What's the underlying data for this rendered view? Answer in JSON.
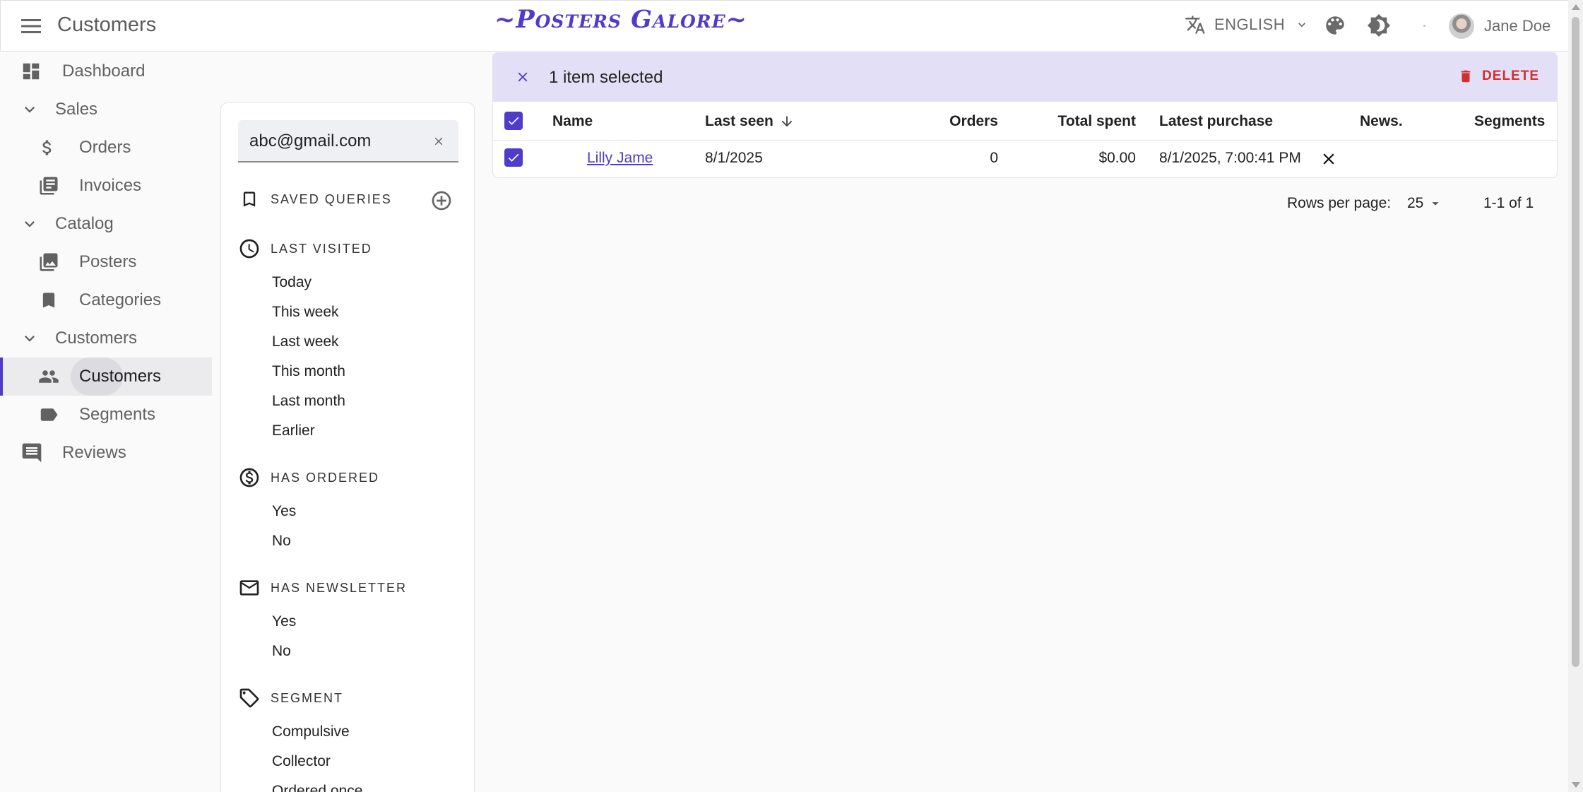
{
  "appbar": {
    "title": "Customers",
    "brand": "~Posters Galore~",
    "language": "ENGLISH",
    "user_name": "Jane Doe"
  },
  "sidebar": {
    "items": [
      {
        "label": "Dashboard",
        "icon": "dashboard-icon"
      },
      {
        "label": "Sales",
        "icon": "chevron-down-icon"
      },
      {
        "label": "Orders",
        "icon": "dollar-icon"
      },
      {
        "label": "Invoices",
        "icon": "invoice-icon"
      },
      {
        "label": "Catalog",
        "icon": "chevron-down-icon"
      },
      {
        "label": "Posters",
        "icon": "image-icon"
      },
      {
        "label": "Categories",
        "icon": "bookmark-icon"
      },
      {
        "label": "Customers",
        "icon": "chevron-down-icon"
      },
      {
        "label": "Customers",
        "icon": "people-icon"
      },
      {
        "label": "Segments",
        "icon": "label-icon"
      },
      {
        "label": "Reviews",
        "icon": "comment-icon"
      }
    ]
  },
  "filters": {
    "search_value": "abc@gmail.com",
    "saved_queries": "SAVED QUERIES",
    "last_visited": {
      "title": "LAST VISITED",
      "options": [
        "Today",
        "This week",
        "Last week",
        "This month",
        "Last month",
        "Earlier"
      ]
    },
    "has_ordered": {
      "title": "HAS ORDERED",
      "options": [
        "Yes",
        "No"
      ]
    },
    "has_newsletter": {
      "title": "HAS NEWSLETTER",
      "options": [
        "Yes",
        "No"
      ]
    },
    "segment": {
      "title": "SEGMENT",
      "options": [
        "Compulsive",
        "Collector",
        "Ordered once"
      ]
    }
  },
  "bulk": {
    "selected_text": "1 item selected",
    "delete_label": "DELETE"
  },
  "table": {
    "headers": [
      "Name",
      "Last seen",
      "Orders",
      "Total spent",
      "Latest purchase",
      "News.",
      "Segments"
    ],
    "rows": [
      {
        "name": "Lilly Jame",
        "last_seen": "8/1/2025",
        "orders": "0",
        "total_spent": "$0.00",
        "latest_purchase": "8/1/2025, 7:00:41 PM",
        "newsletter": "no",
        "segments": ""
      }
    ]
  },
  "pagination": {
    "rows_per_page_label": "Rows per page:",
    "rows_per_page": "25",
    "range": "1-1 of 1"
  },
  "colors": {
    "accent": "#4f3cc9",
    "bulk_bar": "#e3dff6",
    "delete": "#d32f2f"
  }
}
